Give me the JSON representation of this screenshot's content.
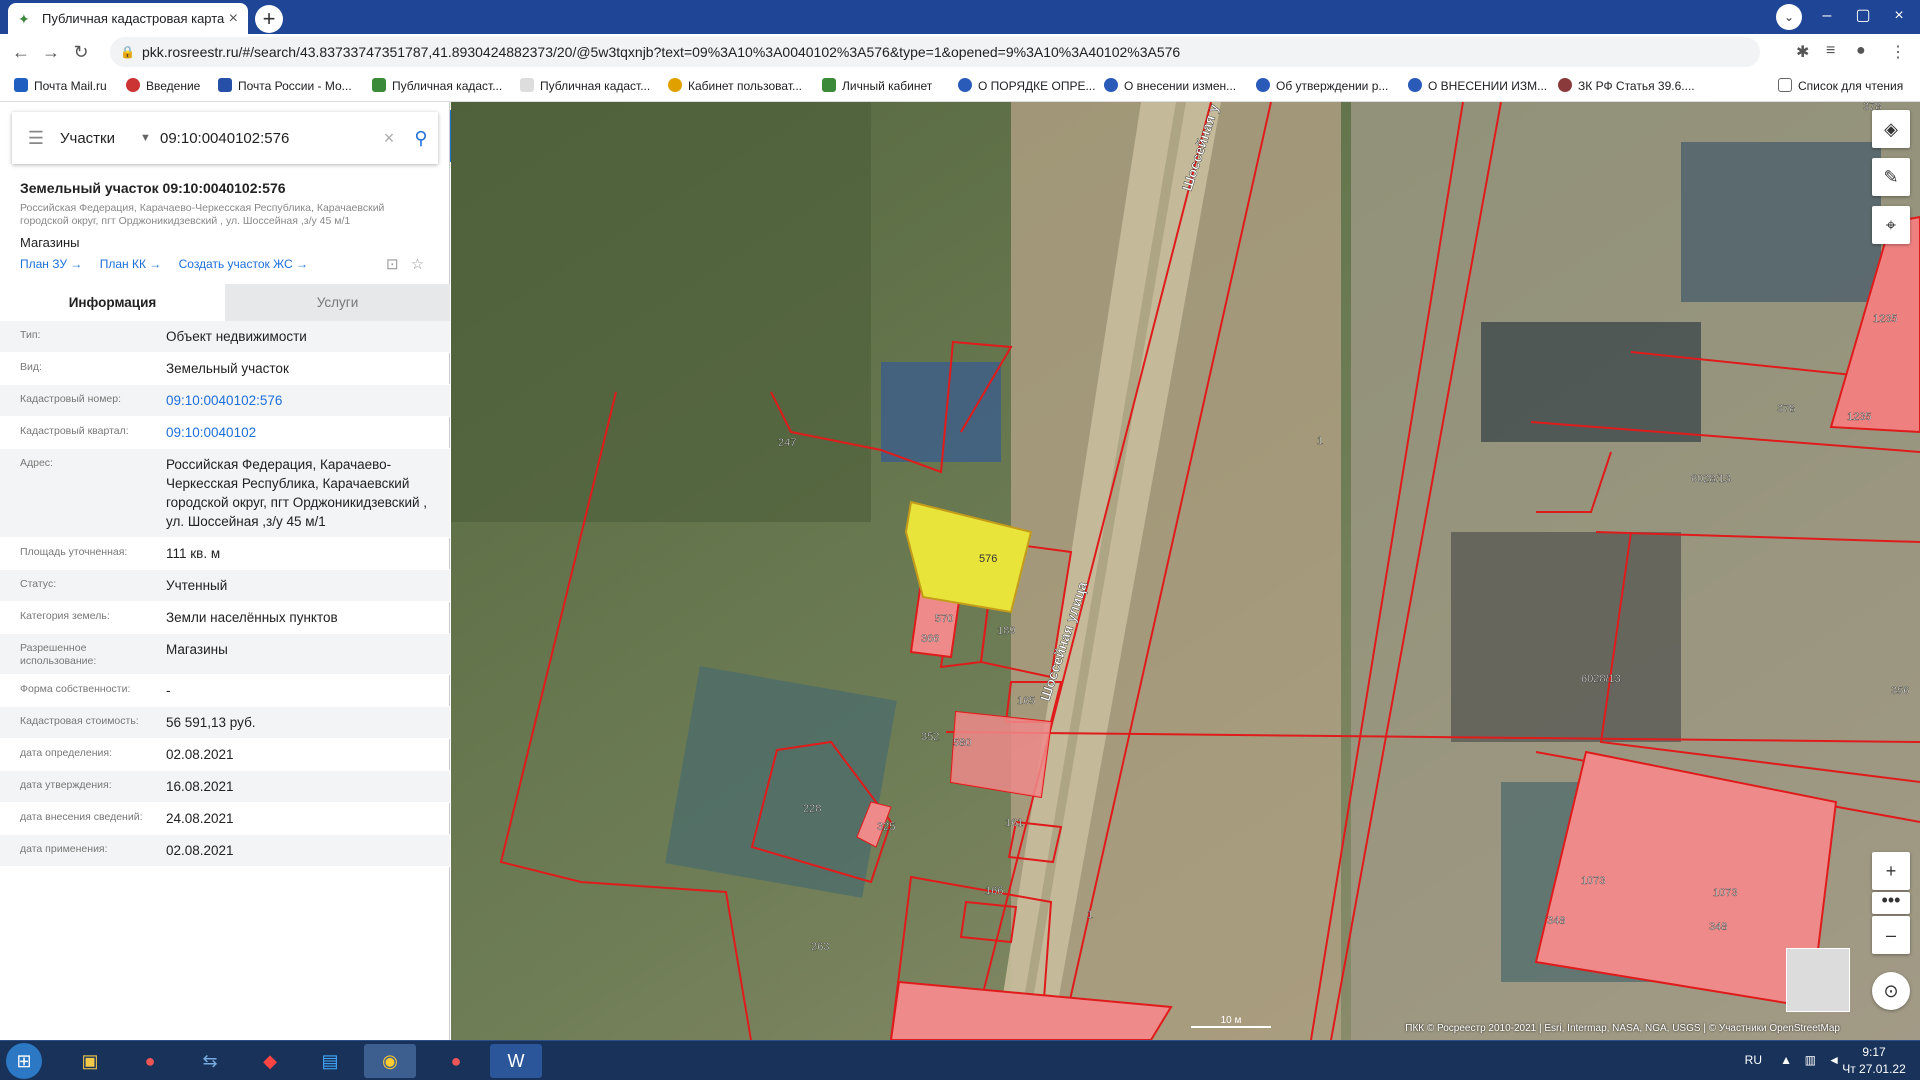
{
  "browser": {
    "tab_title": "Публичная кадастровая карта",
    "url": "pkk.rosreestr.ru/#/search/43.83733747351787,41.8930424882373/20/@5w3tqxnjb?text=09%3A10%3A0040102%3A576&type=1&opened=9%3A10%3A40102%3A576",
    "bookmarks": [
      "Почта Mail.ru",
      "Введение",
      "Почта России - Мо...",
      "Публичная кадаст...",
      "Публичная кадаст...",
      "Кабинет пользоват...",
      "Личный кабинет",
      "О ПОРЯДКЕ ОПРЕ...",
      "О внесении измен...",
      "Об утверждении р...",
      "О ВНЕСЕНИИ ИЗМ...",
      "ЗК РФ Статья 39.6...."
    ],
    "reading_list": "Список для чтения"
  },
  "search": {
    "mode": "Участки",
    "query": "09:10:0040102:576"
  },
  "parcel": {
    "title": "Земельный участок 09:10:0040102:576",
    "address_short": "Российская Федерация, Карачаево-Черкесская Республика, Карачаевский городской округ, пгт Орджоникидзевский , ул. Шоссейная ,з/у 45 м/1",
    "use_type": "Магазины",
    "links": [
      "План ЗУ →",
      "План КК →",
      "Создать участок ЖС →"
    ]
  },
  "tabs": [
    "Информация",
    "Услуги"
  ],
  "info_rows": [
    {
      "k": "Тип:",
      "v": "Объект недвижимости"
    },
    {
      "k": "Вид:",
      "v": "Земельный участок"
    },
    {
      "k": "Кадастровый номер:",
      "v": "09:10:0040102:576"
    },
    {
      "k": "Кадастровый квартал:",
      "v": "09:10:0040102"
    },
    {
      "k": "Адрес:",
      "v": "Российская Федерация, Карачаево-Черкесская Республика, Карачаевский городской округ, пгт Орджоникидзевский , ул. Шоссейная ,з/у 45 м/1"
    },
    {
      "k": "Площадь уточненная:",
      "v": "111 кв. м"
    },
    {
      "k": "Статус:",
      "v": "Учтенный"
    },
    {
      "k": "Категория земель:",
      "v": "Земли населённых пунктов"
    },
    {
      "k": "Разрешенное использование:",
      "v": "Магазины"
    },
    {
      "k": "Форма собственности:",
      "v": "-"
    },
    {
      "k": "Кадастровая стоимость:",
      "v": "56 591,13 руб."
    },
    {
      "k": "дата определения:",
      "v": "02.08.2021"
    },
    {
      "k": "дата утверждения:",
      "v": "16.08.2021"
    },
    {
      "k": "дата внесения сведений:",
      "v": "24.08.2021"
    },
    {
      "k": "дата применения:",
      "v": "02.08.2021"
    }
  ],
  "map": {
    "street": "Шоссейная улица",
    "street_top": "Шоссейная у",
    "labels": [
      "576",
      "247",
      "189",
      "570",
      "366",
      "165",
      "352",
      "580",
      "228",
      "325",
      "161",
      "166",
      "263",
      "1",
      "1",
      "378",
      "1235",
      "1235",
      "378",
      "6028/13",
      "6028/13",
      "356",
      "1073",
      "1073",
      "348",
      "348"
    ],
    "scale": "10 м",
    "attribution": "ПКК © Росреестр 2010-2021 | Esri, Intermap, NASA, NGA, USGS | © Участники OpenStreetMap",
    "highlight_color": "#e8e43a",
    "boundary_color": "#e01b1b"
  },
  "taskbar": {
    "lang": "RU",
    "time": "9:17",
    "date": "Чт 27.01.22"
  }
}
